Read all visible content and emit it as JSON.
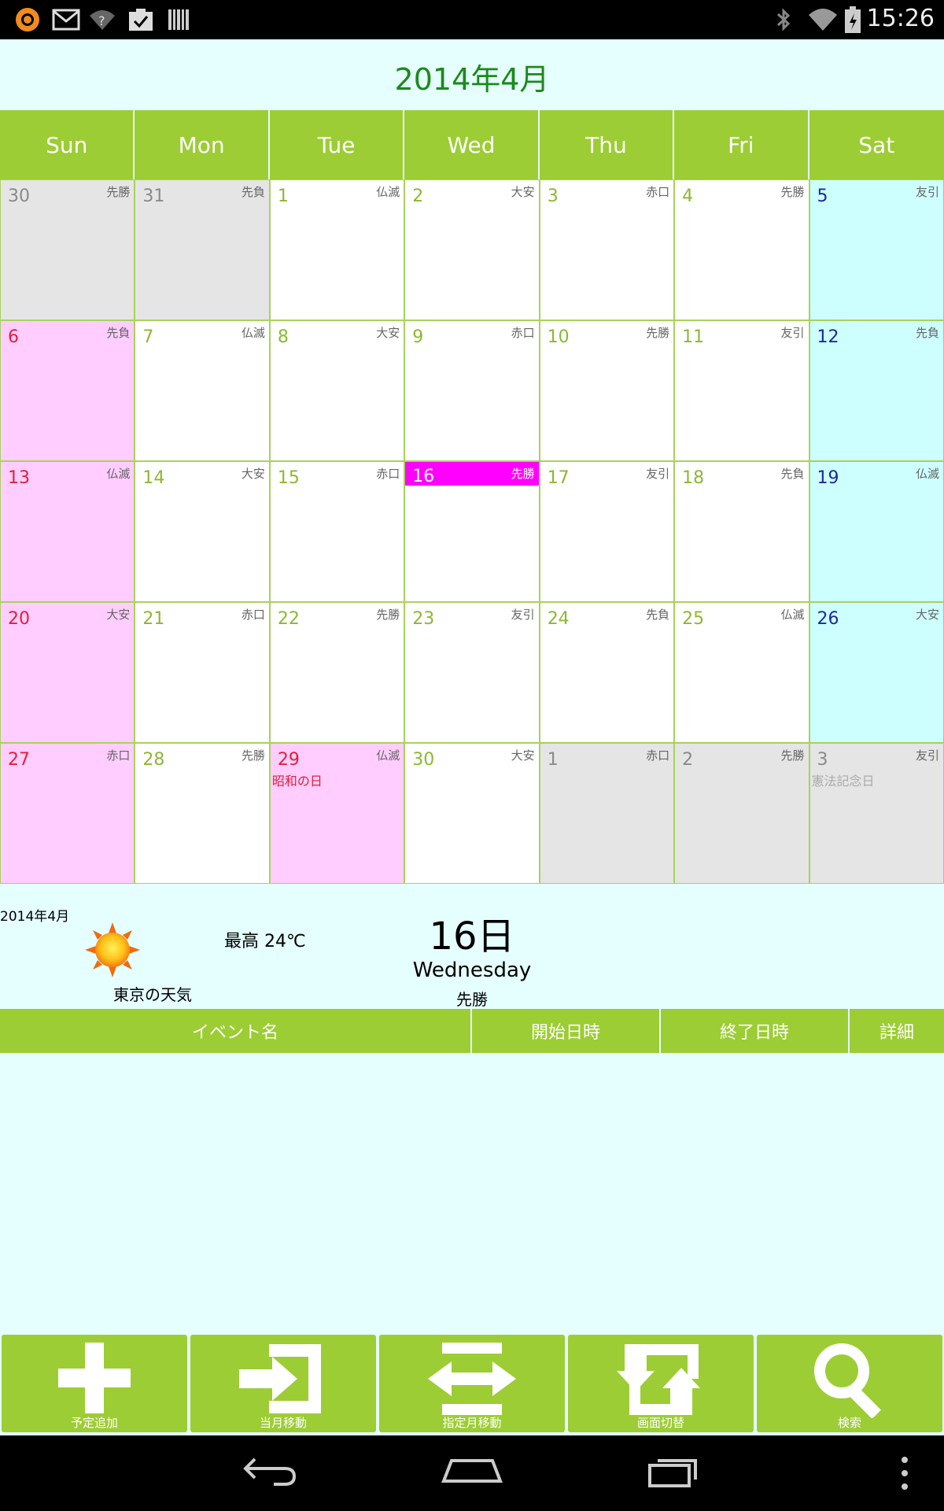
{
  "status_bar": {
    "time": "15:26",
    "left_icons": [
      "app-notification-icon",
      "gmail-icon",
      "wifi-question-icon",
      "task-check-icon",
      "barcode-icon"
    ],
    "right_icons": [
      "bluetooth-icon",
      "wifi-icon",
      "battery-icon"
    ]
  },
  "calendar": {
    "title": "2014年4月",
    "weekdays": [
      "Sun",
      "Mon",
      "Tue",
      "Wed",
      "Thu",
      "Fri",
      "Sat"
    ],
    "weeks": [
      [
        {
          "day": "30",
          "rokuyo": "先勝",
          "type": "other"
        },
        {
          "day": "31",
          "rokuyo": "先負",
          "type": "other"
        },
        {
          "day": "1",
          "rokuyo": "仏滅",
          "type": "normal"
        },
        {
          "day": "2",
          "rokuyo": "大安",
          "type": "normal"
        },
        {
          "day": "3",
          "rokuyo": "赤口",
          "type": "normal"
        },
        {
          "day": "4",
          "rokuyo": "先勝",
          "type": "normal"
        },
        {
          "day": "5",
          "rokuyo": "友引",
          "type": "sat"
        }
      ],
      [
        {
          "day": "6",
          "rokuyo": "先負",
          "type": "sun"
        },
        {
          "day": "7",
          "rokuyo": "仏滅",
          "type": "normal"
        },
        {
          "day": "8",
          "rokuyo": "大安",
          "type": "normal"
        },
        {
          "day": "9",
          "rokuyo": "赤口",
          "type": "normal"
        },
        {
          "day": "10",
          "rokuyo": "先勝",
          "type": "normal"
        },
        {
          "day": "11",
          "rokuyo": "友引",
          "type": "normal"
        },
        {
          "day": "12",
          "rokuyo": "先負",
          "type": "sat"
        }
      ],
      [
        {
          "day": "13",
          "rokuyo": "仏滅",
          "type": "sun"
        },
        {
          "day": "14",
          "rokuyo": "大安",
          "type": "normal"
        },
        {
          "day": "15",
          "rokuyo": "赤口",
          "type": "normal"
        },
        {
          "day": "16",
          "rokuyo": "先勝",
          "type": "today"
        },
        {
          "day": "17",
          "rokuyo": "友引",
          "type": "normal"
        },
        {
          "day": "18",
          "rokuyo": "先負",
          "type": "normal"
        },
        {
          "day": "19",
          "rokuyo": "仏滅",
          "type": "sat"
        }
      ],
      [
        {
          "day": "20",
          "rokuyo": "大安",
          "type": "sun"
        },
        {
          "day": "21",
          "rokuyo": "赤口",
          "type": "normal"
        },
        {
          "day": "22",
          "rokuyo": "先勝",
          "type": "normal"
        },
        {
          "day": "23",
          "rokuyo": "友引",
          "type": "normal"
        },
        {
          "day": "24",
          "rokuyo": "先負",
          "type": "normal"
        },
        {
          "day": "25",
          "rokuyo": "仏滅",
          "type": "normal"
        },
        {
          "day": "26",
          "rokuyo": "大安",
          "type": "sat"
        }
      ],
      [
        {
          "day": "27",
          "rokuyo": "赤口",
          "type": "sun"
        },
        {
          "day": "28",
          "rokuyo": "先勝",
          "type": "normal"
        },
        {
          "day": "29",
          "rokuyo": "仏滅",
          "type": "holiday",
          "holiday": "昭和の日"
        },
        {
          "day": "30",
          "rokuyo": "大安",
          "type": "normal"
        },
        {
          "day": "1",
          "rokuyo": "赤口",
          "type": "other"
        },
        {
          "day": "2",
          "rokuyo": "先勝",
          "type": "other"
        },
        {
          "day": "3",
          "rokuyo": "友引",
          "type": "other sat",
          "holiday": "憲法記念日"
        }
      ]
    ]
  },
  "info": {
    "month": "2014年4月",
    "weather_location": "東京の天気",
    "max_temp": "最高 24℃",
    "selected_day": "16日",
    "selected_weekday": "Wednesday",
    "selected_rokuyo": "先勝"
  },
  "event_table": {
    "columns": [
      "イベント名",
      "開始日時",
      "終了日時",
      "詳細"
    ]
  },
  "toolbar": {
    "buttons": [
      {
        "label": "予定追加",
        "icon": "plus-icon"
      },
      {
        "label": "当月移動",
        "icon": "enter-icon"
      },
      {
        "label": "指定月移動",
        "icon": "left-right-arrows-icon"
      },
      {
        "label": "画面切替",
        "icon": "refresh-icon"
      },
      {
        "label": "検索",
        "icon": "search-icon"
      }
    ]
  },
  "colors": {
    "accent_green": "#9ccd34",
    "background": "#e5fefe",
    "title_green": "#1b8a1b",
    "today_magenta": "#ff00ff",
    "sunday_pink": "#ffcdff",
    "saturday_cyan": "#cdffff"
  }
}
